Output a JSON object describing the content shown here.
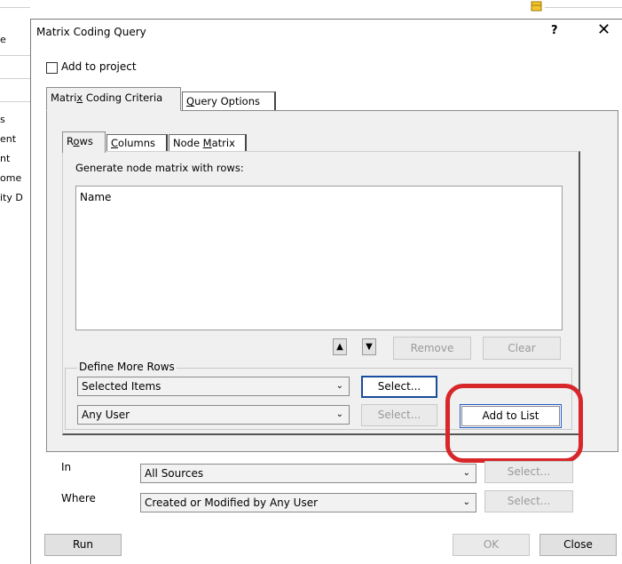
{
  "background": {
    "left_labels": [
      "e",
      "s",
      "ent",
      "nt",
      "ome",
      "ity D"
    ]
  },
  "dialog": {
    "title": "Matrix Coding Query",
    "help_label": "?",
    "close_label": "✕",
    "add_to_project_label": "Add to project",
    "tabs": [
      {
        "label": "Matrix Coding Criteria",
        "active": true
      },
      {
        "label": "Query Options",
        "active": false
      }
    ],
    "inner_tabs": [
      {
        "label": "Rows",
        "active": true
      },
      {
        "label": "Columns",
        "active": false
      },
      {
        "label": "Node Matrix",
        "active": false
      }
    ],
    "rows_caption": "Generate node matrix with rows:",
    "rows_list": [
      "Name"
    ],
    "list_buttons": {
      "up": "▲",
      "down": "▼",
      "remove": "Remove",
      "clear": "Clear"
    },
    "define_more": {
      "legend": "Define More Rows",
      "combo1": "Selected Items",
      "combo2": "Any User",
      "select1": "Select...",
      "select2": "Select...",
      "add_to_list": "Add to List"
    },
    "scope": {
      "in_label": "In",
      "in_value": "All Sources",
      "in_select": "Select...",
      "where_label": "Where",
      "where_value": "Created or Modified by Any User",
      "where_select": "Select..."
    },
    "footer": {
      "run": "Run",
      "ok": "OK",
      "close": "Close"
    }
  },
  "colors": {
    "highlight": "#d8272b",
    "focus": "#1a4c9c"
  }
}
